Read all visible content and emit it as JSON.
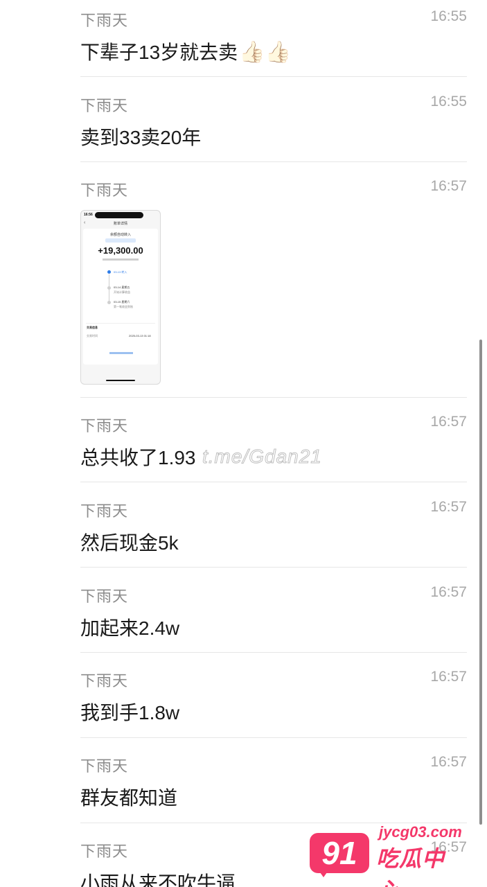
{
  "messages": [
    {
      "sender": "下雨天",
      "time": "16:55",
      "text": "下辈子13岁就去卖",
      "emoji": "👍🏻👍🏻"
    },
    {
      "sender": "下雨天",
      "time": "16:55",
      "text": "卖到33卖20年"
    },
    {
      "sender": "下雨天",
      "time": "16:57",
      "image": {
        "status_time": "16:56",
        "title": "账单详情",
        "heading": "余额自动转入",
        "amount": "+19,300.00",
        "step1": "03-13 转入",
        "step2": "03-14 星期五",
        "step2_sub": "开始计算收益",
        "step3": "03-15 星期六",
        "step3_sub": "第一笔收益到账",
        "section": "交易信息",
        "row_label": "交易时间",
        "row_value": "2025-03-13 01:18"
      }
    },
    {
      "sender": "下雨天",
      "time": "16:57",
      "text": "总共收了1.93"
    },
    {
      "sender": "下雨天",
      "time": "16:57",
      "text": "然后现金5k"
    },
    {
      "sender": "下雨天",
      "time": "16:57",
      "text": "加起来2.4w"
    },
    {
      "sender": "下雨天",
      "time": "16:57",
      "text": "我到手1.8w"
    },
    {
      "sender": "下雨天",
      "time": "16:57",
      "text": "群友都知道"
    },
    {
      "sender": "下雨天",
      "time": "16:57",
      "text": "小雨从来不吹牛逼"
    }
  ],
  "watermark": "t.me/Gdan21",
  "logo": {
    "number": "91",
    "domain": "jycg03.com",
    "name": "吃瓜中心"
  },
  "colors": {
    "accent": "#f4386a",
    "divider": "#e6e6e6",
    "meta": "#a8a8a8"
  }
}
